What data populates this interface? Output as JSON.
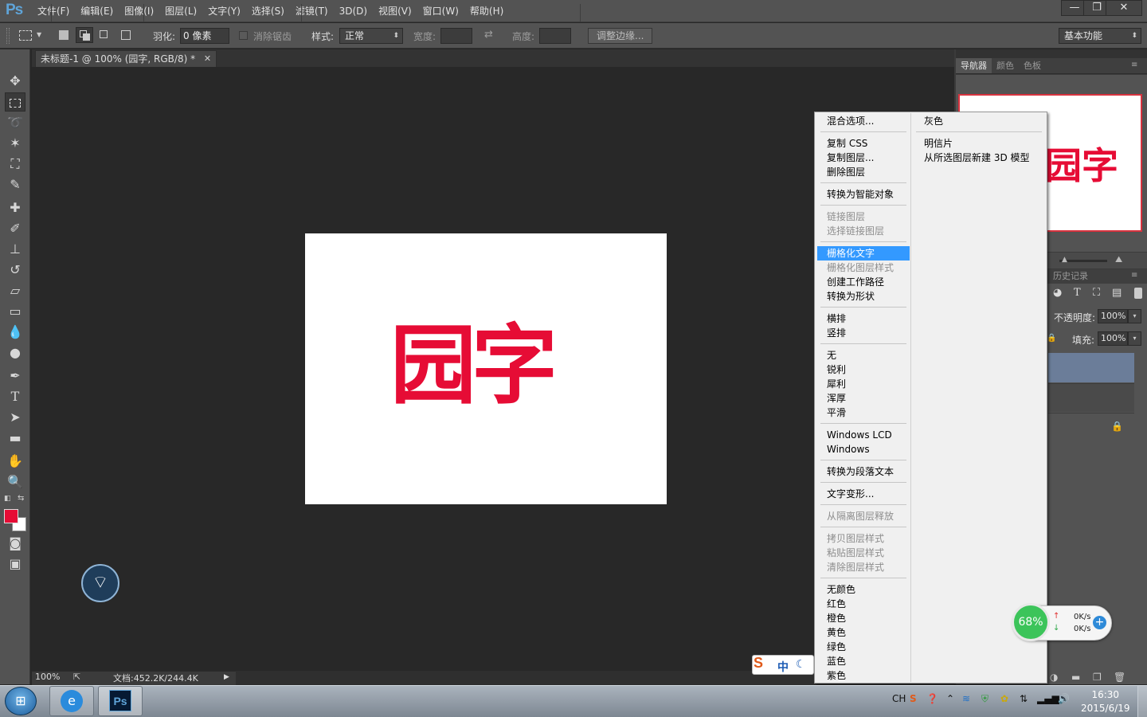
{
  "app": {
    "logo": "Ps",
    "menu": [
      "文件(F)",
      "编辑(E)",
      "图像(I)",
      "图层(L)",
      "文字(Y)",
      "选择(S)",
      "滤镜(T)",
      "3D(D)",
      "视图(V)",
      "窗口(W)",
      "帮助(H)"
    ],
    "window_buttons": {
      "minimize": "—",
      "restore": "❐",
      "close": "✕"
    }
  },
  "options": {
    "feather_label": "羽化:",
    "feather_value": "0 像素",
    "antialias_label": "消除锯齿",
    "style_label": "样式:",
    "style_value": "正常",
    "width_label": "宽度:",
    "height_label": "高度:",
    "refine_edge_label": "调整边缘...",
    "workspace_value": "基本功能"
  },
  "document": {
    "tab_title": "未标题-1 @ 100% (园字, RGB/8) *",
    "canvas_text": "园字",
    "zoom": "100%",
    "doc_info": "文档:452.2K/244.4K",
    "foreground_color": "#e60c35"
  },
  "panels": {
    "tabs": [
      "导航器",
      "颜色",
      "色板"
    ],
    "history_tab": "历史记录",
    "opacity_label": "不透明度:",
    "opacity_value": "100%",
    "fill_label": "填充:",
    "fill_value": "100%"
  },
  "context_menu": {
    "col1": [
      {
        "label": "混合选项...",
        "enabled": true
      },
      {
        "sep": true
      },
      {
        "label": "复制 CSS",
        "enabled": true
      },
      {
        "label": "复制图层...",
        "enabled": true
      },
      {
        "label": "删除图层",
        "enabled": true
      },
      {
        "sep": true
      },
      {
        "label": "转换为智能对象",
        "enabled": true
      },
      {
        "sep": true
      },
      {
        "label": "链接图层",
        "enabled": false
      },
      {
        "label": "选择链接图层",
        "enabled": false
      },
      {
        "sep": true
      },
      {
        "label": "栅格化文字",
        "enabled": true,
        "highlighted": true
      },
      {
        "label": "栅格化图层样式",
        "enabled": false
      },
      {
        "label": "创建工作路径",
        "enabled": true
      },
      {
        "label": "转换为形状",
        "enabled": true
      },
      {
        "sep": true
      },
      {
        "label": "横排",
        "enabled": true
      },
      {
        "label": "竖排",
        "enabled": true
      },
      {
        "sep": true
      },
      {
        "label": "无",
        "enabled": true
      },
      {
        "label": "锐利",
        "enabled": true
      },
      {
        "label": "犀利",
        "enabled": true
      },
      {
        "label": "浑厚",
        "enabled": true
      },
      {
        "label": "平滑",
        "enabled": true
      },
      {
        "sep": true
      },
      {
        "label": "Windows LCD",
        "enabled": true
      },
      {
        "label": "Windows",
        "enabled": true
      },
      {
        "sep": true
      },
      {
        "label": "转换为段落文本",
        "enabled": true
      },
      {
        "sep": true
      },
      {
        "label": "文字变形...",
        "enabled": true
      },
      {
        "sep": true
      },
      {
        "label": "从隔离图层释放",
        "enabled": false
      },
      {
        "sep": true
      },
      {
        "label": "拷贝图层样式",
        "enabled": false
      },
      {
        "label": "粘贴图层样式",
        "enabled": false
      },
      {
        "label": "清除图层样式",
        "enabled": false
      },
      {
        "sep": true
      },
      {
        "label": "无颜色",
        "enabled": true
      },
      {
        "label": "红色",
        "enabled": true
      },
      {
        "label": "橙色",
        "enabled": true
      },
      {
        "label": "黄色",
        "enabled": true
      },
      {
        "label": "绿色",
        "enabled": true
      },
      {
        "label": "蓝色",
        "enabled": true
      },
      {
        "label": "紫色",
        "enabled": true
      }
    ],
    "col2": [
      {
        "label": "灰色"
      },
      {
        "sep": true
      },
      {
        "label": "明信片"
      },
      {
        "label": "从所选图层新建 3D 模型"
      }
    ]
  },
  "overlays": {
    "ime_mode": "中",
    "net_percent": "68%",
    "up_speed": "0K/s",
    "down_speed": "0K/s"
  },
  "taskbar": {
    "lang": "CH",
    "time": "16:30",
    "date": "2015/6/19",
    "ps_label": "Ps"
  }
}
